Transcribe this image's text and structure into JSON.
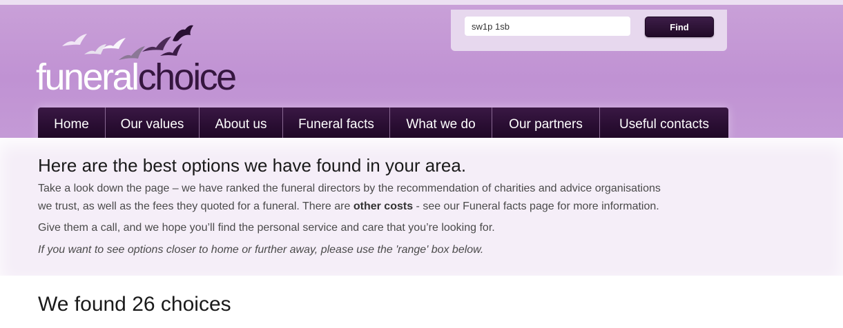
{
  "logo": {
    "word1": "funeral",
    "word2": "choice"
  },
  "search": {
    "value": "sw1p 1sb",
    "button_label": "Find"
  },
  "nav": [
    {
      "label": "Home"
    },
    {
      "label": "Our values"
    },
    {
      "label": "About us"
    },
    {
      "label": "Funeral facts"
    },
    {
      "label": "What we do"
    },
    {
      "label": "Our partners"
    },
    {
      "label": "Useful contacts"
    }
  ],
  "intro": {
    "heading": "Here are the best options we have found in your area.",
    "p1_line1": "Take a look down the page – we have ranked the funeral directors by the recommendation of charities and advice organisations",
    "p1_line2_a": "we trust, as well as the fees they quoted for a funeral. There are ",
    "p1_line2_strong": "other costs",
    "p1_line2_b": " - see our Funeral facts page for more information.",
    "p2": "Give them a call, and we hope you’ll find the personal service and care that you’re looking for.",
    "p3": "If you want to see options closer to home or further away, please use the 'range' box below."
  },
  "results": {
    "title": "We found 26 choices"
  },
  "colors": {
    "header": "#c092d3",
    "nav": "#2a0e33",
    "logo_dark": "#35163f",
    "intro_bg": "#f5eef8"
  }
}
